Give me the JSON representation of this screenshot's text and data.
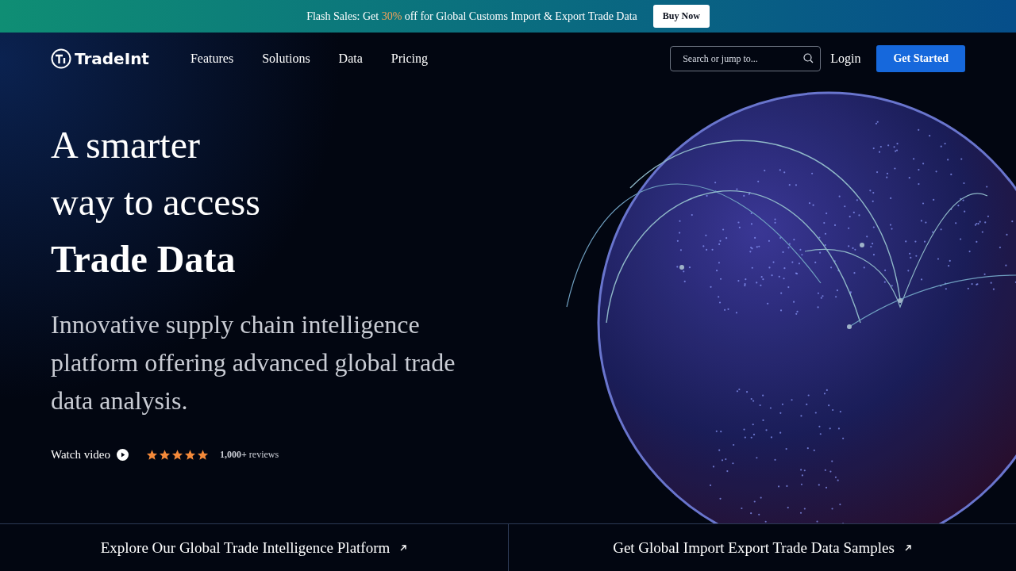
{
  "promo_bar": {
    "text": "Flash Sales: Get **30%** off for Global Customs Import & Export Trade Data",
    "button": "Buy Now"
  },
  "nav": {
    "logo": "TradeInt",
    "links": [
      "Features",
      "Solutions",
      "Data",
      "Pricing"
    ],
    "search": {
      "placeholder": "Search or jump to..."
    },
    "login": "Login",
    "cta": "Get Started"
  },
  "hero": {
    "title_lines": [
      "A smarter",
      "way to access"
    ],
    "title_emphasis": "Trade  Data",
    "subtitle": "Innovative supply chain intelligence platform offering advanced global trade data analysis.",
    "watch_video": "Watch video",
    "stars": 5,
    "reviews": "**1,000+** reviews"
  },
  "bottom_links": [
    "Explore Our Global Trade Intelligence Platform",
    "Get Global Import Export Trade Data Samples"
  ]
}
